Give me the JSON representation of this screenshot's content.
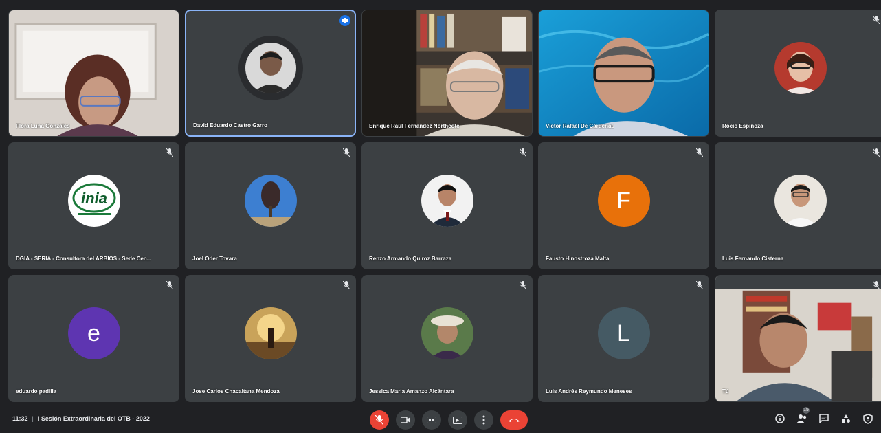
{
  "meeting": {
    "time": "11:32",
    "separator": "|",
    "title": "I Sesión Extraordinaria del OTB - 2022"
  },
  "participants": [
    {
      "name": "Flora Luna Gonzales",
      "type": "video",
      "speaking": false
    },
    {
      "name": "David Eduardo Castro Garro",
      "type": "avatar-photo",
      "speaking": true
    },
    {
      "name": "Enrique Raúl Fernandez Northcote",
      "type": "video",
      "speaking": false
    },
    {
      "name": "Victor Rafael De Cárdenas",
      "type": "video",
      "speaking": false
    },
    {
      "name": "Rocío Espinoza",
      "type": "avatar-photo",
      "speaking": false
    },
    {
      "name": "DGIA - SERIA - Consultora del ARBIOS - Sede Cen...",
      "type": "avatar-logo",
      "logo_text": "inia",
      "speaking": false
    },
    {
      "name": "Joel Oder Tovara",
      "type": "avatar-photo",
      "speaking": false
    },
    {
      "name": "Renzo Armando Quiroz Barraza",
      "type": "avatar-photo",
      "speaking": false
    },
    {
      "name": "Fausto Hinostroza Malta",
      "type": "avatar-letter",
      "letter": "F",
      "color": "#e8710a",
      "speaking": false
    },
    {
      "name": "Luis Fernando Cisterna",
      "type": "avatar-photo",
      "speaking": false
    },
    {
      "name": "eduardo padilla",
      "type": "avatar-letter",
      "letter": "e",
      "color": "#5e35b1",
      "speaking": false
    },
    {
      "name": "Jose Carlos Chacaltana Mendoza",
      "type": "avatar-photo",
      "speaking": false
    },
    {
      "name": "Jessica Maria Amanzo Alcántara",
      "type": "avatar-photo",
      "speaking": false
    },
    {
      "name": "Luis Andrés Reymundo Meneses",
      "type": "avatar-letter",
      "letter": "L",
      "color": "#455a64",
      "speaking": false
    },
    {
      "name": "Tú",
      "type": "video",
      "speaking": false
    }
  ],
  "controls": [
    "mic-off-icon",
    "camera-icon",
    "captions-icon",
    "present-icon",
    "more-icon",
    "end-call-icon"
  ],
  "right_icons": [
    "info-icon",
    "people-icon",
    "chat-icon",
    "activities-icon",
    "host-controls-icon"
  ],
  "people_count": "15",
  "colors": {
    "background": "#202124",
    "tile": "#3c4043",
    "danger": "#ea4335",
    "accent": "#1a73e8"
  }
}
